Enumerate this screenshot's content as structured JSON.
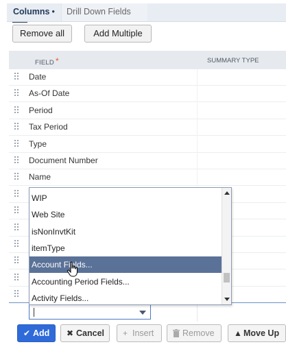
{
  "tabs": {
    "columns": "Columns",
    "separator": "•",
    "drill_down": "Drill Down Fields"
  },
  "toolbar": {
    "remove_all": "Remove all",
    "add_multiple": "Add Multiple"
  },
  "grid": {
    "header_field": "FIELD",
    "required_marker": "*",
    "header_summary": "SUMMARY TYPE",
    "rows": [
      {
        "label": "Date"
      },
      {
        "label": "As-Of Date"
      },
      {
        "label": "Period"
      },
      {
        "label": "Tax Period"
      },
      {
        "label": "Type"
      },
      {
        "label": "Document Number"
      },
      {
        "label": "Name"
      },
      {
        "label": ""
      },
      {
        "label": ""
      },
      {
        "label": ""
      },
      {
        "label": ""
      },
      {
        "label": ""
      },
      {
        "label": ""
      },
      {
        "label": ""
      }
    ]
  },
  "edit_row": {
    "value": ""
  },
  "dropdown": {
    "items": [
      {
        "label": "WIP",
        "selected": false
      },
      {
        "label": "Web Site",
        "selected": false
      },
      {
        "label": "isNonInvtKit",
        "selected": false
      },
      {
        "label": "itemType",
        "selected": false
      },
      {
        "label": "Account Fields...",
        "selected": true
      },
      {
        "label": "Accounting Period Fields...",
        "selected": false
      },
      {
        "label": "Activity Fields...",
        "selected": false
      }
    ]
  },
  "actions": {
    "add": "Add",
    "cancel": "Cancel",
    "insert": "Insert",
    "remove": "Remove",
    "move_up": "Move Up"
  },
  "icons": {
    "add": "check-icon",
    "cancel": "x-icon",
    "insert": "plus-icon",
    "remove": "trash-icon",
    "move_up": "arrow-up-icon"
  },
  "colors": {
    "accent": "#2f6ad9",
    "selection": "#5b7298",
    "header_bg": "#e6e9ee"
  }
}
